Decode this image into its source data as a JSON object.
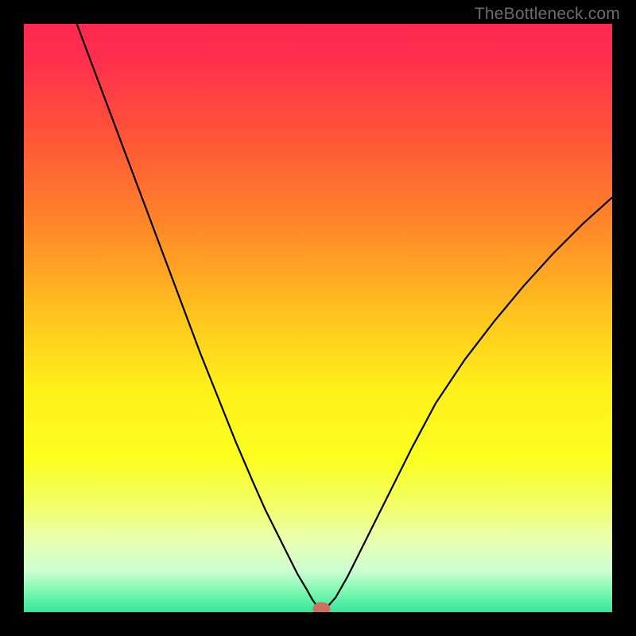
{
  "watermark": "TheBottleneck.com",
  "chart_data": {
    "type": "line",
    "title": "",
    "xlabel": "",
    "ylabel": "",
    "xlim": [
      0,
      100
    ],
    "ylim": [
      0,
      100
    ],
    "gradient_stops": [
      {
        "offset": 0.0,
        "color": "#ff2850"
      },
      {
        "offset": 0.06,
        "color": "#ff2f4e"
      },
      {
        "offset": 0.2,
        "color": "#ff5736"
      },
      {
        "offset": 0.35,
        "color": "#ff8a28"
      },
      {
        "offset": 0.5,
        "color": "#ffc61e"
      },
      {
        "offset": 0.62,
        "color": "#fff01a"
      },
      {
        "offset": 0.74,
        "color": "#fbff20"
      },
      {
        "offset": 0.82,
        "color": "#f2ff6a"
      },
      {
        "offset": 0.88,
        "color": "#e8ffb3"
      },
      {
        "offset": 0.93,
        "color": "#ccffd2"
      },
      {
        "offset": 0.965,
        "color": "#7cf8b2"
      },
      {
        "offset": 1.0,
        "color": "#34e59a"
      }
    ],
    "series": [
      {
        "name": "bottleneck-curve",
        "x": [
          9,
          12,
          15,
          18,
          21,
          24,
          27,
          30,
          33,
          36,
          39,
          41,
          43,
          45,
          46.5,
          48,
          49,
          50,
          51.5,
          53,
          55,
          58,
          62,
          66,
          70,
          75,
          80,
          85,
          90,
          95,
          100
        ],
        "y": [
          100,
          92,
          84,
          76,
          68,
          60,
          52,
          44,
          36.5,
          29,
          22,
          17.5,
          13.5,
          9.5,
          6.5,
          4,
          2.2,
          0.8,
          0.8,
          2.5,
          6,
          12,
          20,
          28,
          35.5,
          43,
          49.5,
          55.5,
          61,
          66,
          70.5
        ]
      }
    ],
    "marker": {
      "x": 50.6,
      "y": 0.6,
      "rx": 1.5,
      "ry": 1.1,
      "color": "#cf6e5c"
    }
  }
}
